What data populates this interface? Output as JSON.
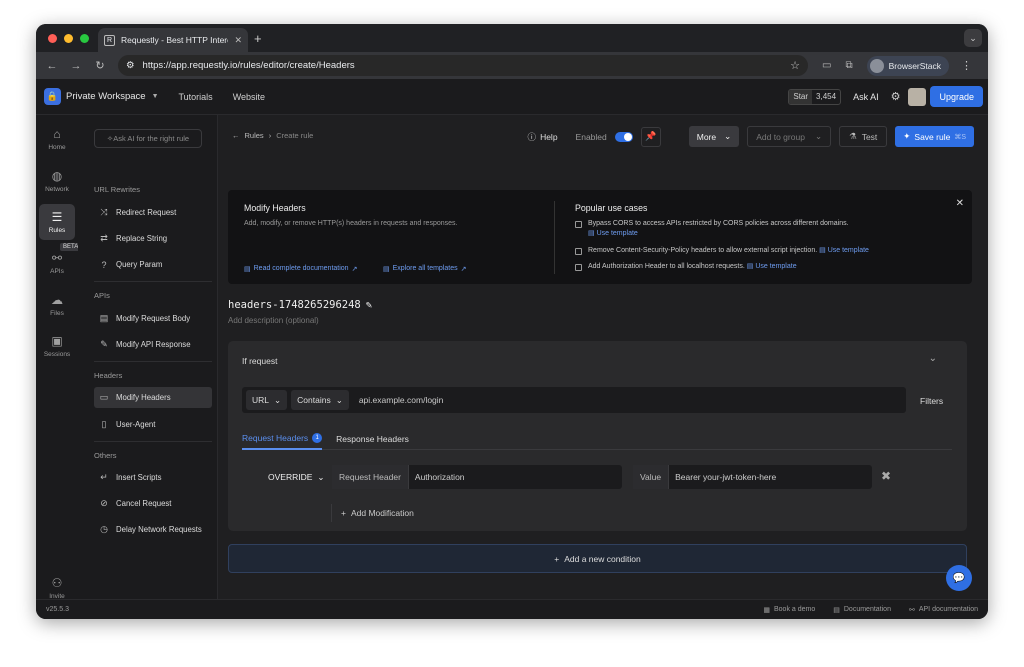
{
  "browser": {
    "tab_title": "Requestly - Best HTTP Interc",
    "tab_favicon": "R",
    "url": "https://app.requestly.io/rules/editor/create/Headers",
    "profile": "BrowserStack"
  },
  "app_header": {
    "workspace": "Private Workspace",
    "links": [
      "Tutorials",
      "Website"
    ],
    "github_label": "Star",
    "github_count": "3,454",
    "ask_ai": "Ask AI",
    "upgrade": "Upgrade"
  },
  "rail": {
    "items": [
      "Home",
      "Network",
      "Rules",
      "APIs",
      "Files",
      "Sessions"
    ],
    "beta_badge": "BETA",
    "invite": "Invite"
  },
  "sidebar": {
    "search_placeholder": "Ask AI for the right rule",
    "sections": [
      {
        "title": "URL Rewrites",
        "items": [
          "Redirect Request",
          "Replace String",
          "Query Param"
        ]
      },
      {
        "title": "APIs",
        "items": [
          "Modify Request Body",
          "Modify API Response"
        ]
      },
      {
        "title": "Headers",
        "items": [
          "Modify Headers",
          "User-Agent"
        ]
      },
      {
        "title": "Others",
        "items": [
          "Insert Scripts",
          "Cancel Request",
          "Delay Network Requests"
        ]
      }
    ]
  },
  "toolbar": {
    "breadcrumb_root": "Rules",
    "breadcrumb_current": "Create rule",
    "help": "Help",
    "enabled": "Enabled",
    "more": "More",
    "add_to_group": "Add to group",
    "test": "Test",
    "save": "Save rule",
    "save_shortcut": "⌘S"
  },
  "banner": {
    "title": "Modify Headers",
    "description": "Add, modify, or remove HTTP(s) headers in requests and responses.",
    "doc_link": "Read complete documentation",
    "templates_link": "Explore all templates",
    "use_cases_title": "Popular use cases",
    "use_cases": [
      "Bypass CORS to access APIs restricted by CORS policies across different domains.",
      "Remove Content-Security-Policy headers to allow external script injection.",
      "Add Authorization Header to all localhost requests."
    ],
    "use_template": "Use template"
  },
  "rule": {
    "name": "headers-1748265296248",
    "description_placeholder": "Add description (optional)"
  },
  "condition": {
    "title": "If request",
    "source_type": "URL",
    "operator": "Contains",
    "value": "api.example.com/login",
    "filters": "Filters",
    "tab_request": "Request Headers",
    "tab_request_count": "1",
    "tab_response": "Response Headers",
    "modification": {
      "action": "OVERRIDE",
      "header_label": "Request Header",
      "header_value": "Authorization",
      "value_label": "Value",
      "value_value": "Bearer your-jwt-token-here"
    },
    "add_modification": "Add Modification",
    "add_condition": "Add a new condition"
  },
  "footer": {
    "version": "v25.5.3",
    "links": [
      "Book a demo",
      "Documentation",
      "API documentation"
    ]
  },
  "colors": {
    "accent": "#2f6fe4",
    "background": "#1b1b1d"
  }
}
